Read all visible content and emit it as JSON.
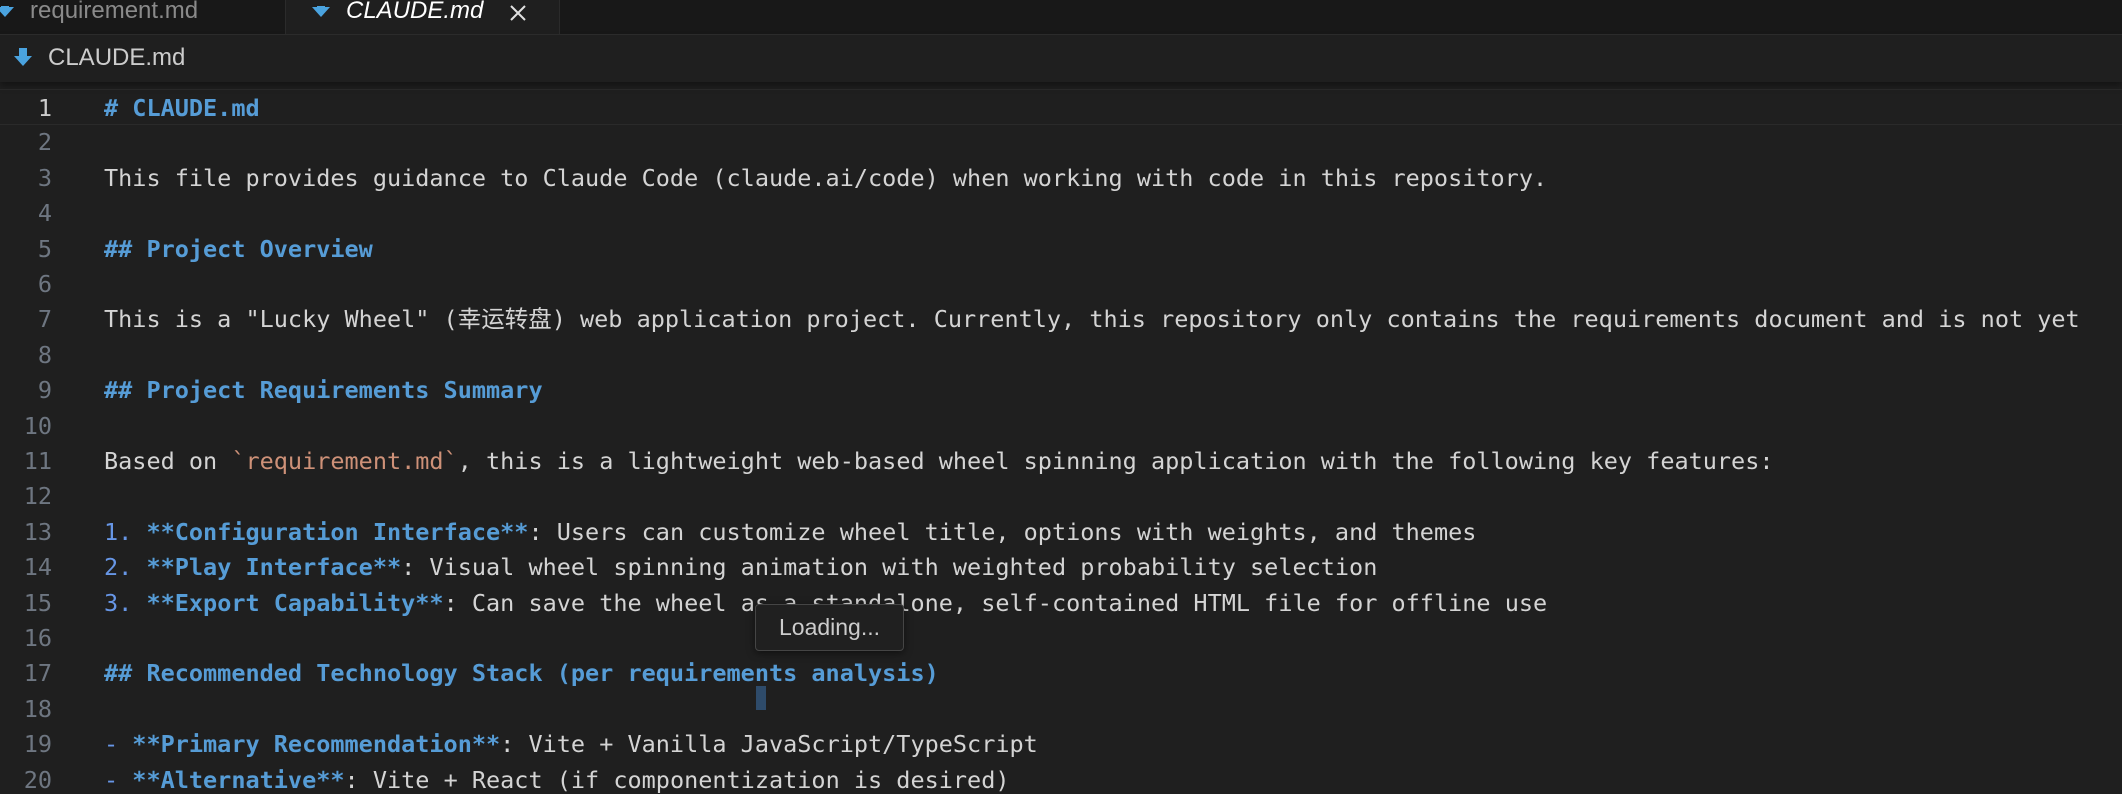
{
  "tabs": [
    {
      "label": "requirement.md",
      "active": false,
      "icon": "markdown-icon"
    },
    {
      "label": "CLAUDE.md",
      "active": true,
      "icon": "markdown-icon"
    }
  ],
  "breadcrumb": {
    "file": "CLAUDE.md",
    "icon": "markdown-icon"
  },
  "editor": {
    "current_line": 1,
    "lines": [
      {
        "n": "1",
        "parts": [
          {
            "t": "# CLAUDE.md",
            "c": "h"
          }
        ]
      },
      {
        "n": "2",
        "parts": []
      },
      {
        "n": "3",
        "parts": [
          {
            "t": "This file provides guidance to Claude Code (claude.ai/code) when working with code in this repository.",
            "c": ""
          }
        ]
      },
      {
        "n": "4",
        "parts": []
      },
      {
        "n": "5",
        "parts": [
          {
            "t": "## Project Overview",
            "c": "h"
          }
        ]
      },
      {
        "n": "6",
        "parts": []
      },
      {
        "n": "7",
        "parts": [
          {
            "t": "This is a \"Lucky Wheel\" (幸运转盘) web application project. Currently, this repository only contains the requirements document and is not yet",
            "c": ""
          }
        ]
      },
      {
        "n": "8",
        "parts": []
      },
      {
        "n": "9",
        "parts": [
          {
            "t": "## Project Requirements Summary",
            "c": "h"
          }
        ]
      },
      {
        "n": "10",
        "parts": []
      },
      {
        "n": "11",
        "parts": [
          {
            "t": "Based on ",
            "c": ""
          },
          {
            "t": "`requirement.md`",
            "c": "inlinecode"
          },
          {
            "t": ", this is a lightweight web-based wheel spinning application with the following key features:",
            "c": ""
          }
        ]
      },
      {
        "n": "12",
        "parts": []
      },
      {
        "n": "13",
        "parts": [
          {
            "t": "1. ",
            "c": "num"
          },
          {
            "t": "**Configuration Interface**",
            "c": "bold"
          },
          {
            "t": ": Users can customize wheel title, options with weights, and themes",
            "c": ""
          }
        ]
      },
      {
        "n": "14",
        "parts": [
          {
            "t": "2. ",
            "c": "num"
          },
          {
            "t": "**Play Interface**",
            "c": "bold"
          },
          {
            "t": ": Visual wheel spinning animation with weighted probability selection",
            "c": ""
          }
        ]
      },
      {
        "n": "15",
        "parts": [
          {
            "t": "3. ",
            "c": "num"
          },
          {
            "t": "**Export Capability**",
            "c": "bold"
          },
          {
            "t": ": Can save the wheel as a standalone, self-contained HTML file for offline use",
            "c": ""
          }
        ]
      },
      {
        "n": "16",
        "parts": []
      },
      {
        "n": "17",
        "parts": [
          {
            "t": "## Recommended Technology Stack (per requirements analysis)",
            "c": "h"
          }
        ]
      },
      {
        "n": "18",
        "parts": []
      },
      {
        "n": "19",
        "parts": [
          {
            "t": "- ",
            "c": "num"
          },
          {
            "t": "**Primary Recommendation**",
            "c": "bold"
          },
          {
            "t": ": Vite + Vanilla JavaScript/TypeScript",
            "c": ""
          }
        ]
      },
      {
        "n": "20",
        "parts": [
          {
            "t": "- ",
            "c": "num"
          },
          {
            "t": "**Alternative**",
            "c": "bold"
          },
          {
            "t": ": Vite + React (if componentization is desired)",
            "c": ""
          }
        ]
      }
    ]
  },
  "tooltip": {
    "text": "Loading..."
  },
  "colors": {
    "background": "#1f1f1f",
    "heading": "#569cd6",
    "inline_code": "#ce9178",
    "text": "#d4d4d4",
    "line_number": "#6e7681",
    "markdown_icon": "#4aa3df"
  }
}
